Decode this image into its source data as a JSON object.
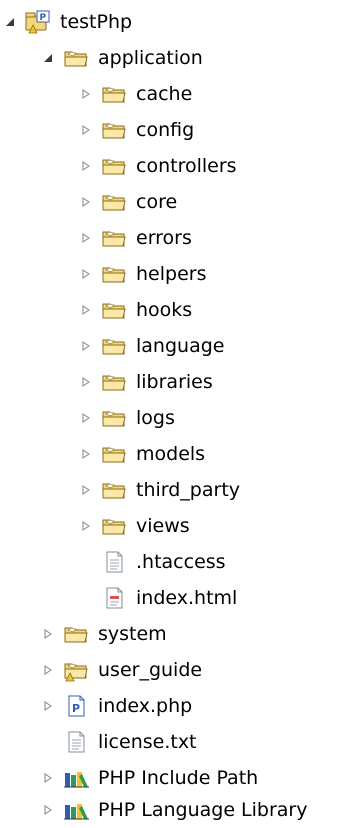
{
  "tree": {
    "project": {
      "label": "testPhp",
      "icon": "php-project-icon",
      "expanded": true
    },
    "application": {
      "label": "application",
      "icon": "folder-icon",
      "expanded": true
    },
    "application_children": [
      {
        "label": "cache",
        "icon": "folder-icon",
        "twisty": "collapsed"
      },
      {
        "label": "config",
        "icon": "folder-icon",
        "twisty": "collapsed"
      },
      {
        "label": "controllers",
        "icon": "folder-icon",
        "twisty": "collapsed"
      },
      {
        "label": "core",
        "icon": "folder-icon",
        "twisty": "collapsed"
      },
      {
        "label": "errors",
        "icon": "folder-icon",
        "twisty": "collapsed"
      },
      {
        "label": "helpers",
        "icon": "folder-icon",
        "twisty": "collapsed"
      },
      {
        "label": "hooks",
        "icon": "folder-icon",
        "twisty": "collapsed"
      },
      {
        "label": "language",
        "icon": "folder-icon",
        "twisty": "collapsed"
      },
      {
        "label": "libraries",
        "icon": "folder-icon",
        "twisty": "collapsed"
      },
      {
        "label": "logs",
        "icon": "folder-icon",
        "twisty": "collapsed"
      },
      {
        "label": "models",
        "icon": "folder-icon",
        "twisty": "collapsed"
      },
      {
        "label": "third_party",
        "icon": "folder-icon",
        "twisty": "collapsed"
      },
      {
        "label": "views",
        "icon": "folder-icon",
        "twisty": "collapsed"
      },
      {
        "label": ".htaccess",
        "icon": "text-file-icon",
        "twisty": "none"
      },
      {
        "label": "index.html",
        "icon": "html-file-icon",
        "twisty": "none"
      }
    ],
    "root_children": [
      {
        "label": "system",
        "icon": "folder-icon",
        "twisty": "collapsed"
      },
      {
        "label": "user_guide",
        "icon": "folder-warning-icon",
        "twisty": "collapsed"
      },
      {
        "label": "index.php",
        "icon": "php-file-icon",
        "twisty": "collapsed"
      },
      {
        "label": "license.txt",
        "icon": "text-file-icon",
        "twisty": "none"
      },
      {
        "label": "PHP Include Path",
        "icon": "library-icon",
        "twisty": "collapsed"
      },
      {
        "label": "PHP Language Library",
        "icon": "library-icon",
        "twisty": "collapsed"
      }
    ]
  },
  "colors": {
    "folder_fill": "#f5d77a",
    "folder_stroke": "#8a6d1d",
    "twisty_open": "#3a3a3a",
    "twisty_closed": "#9a9a9a",
    "file_stroke": "#7f8f9f",
    "php_blue": "#2f5fb3",
    "library_green": "#2e9e4a",
    "warning_yellow": "#f2c12e"
  }
}
